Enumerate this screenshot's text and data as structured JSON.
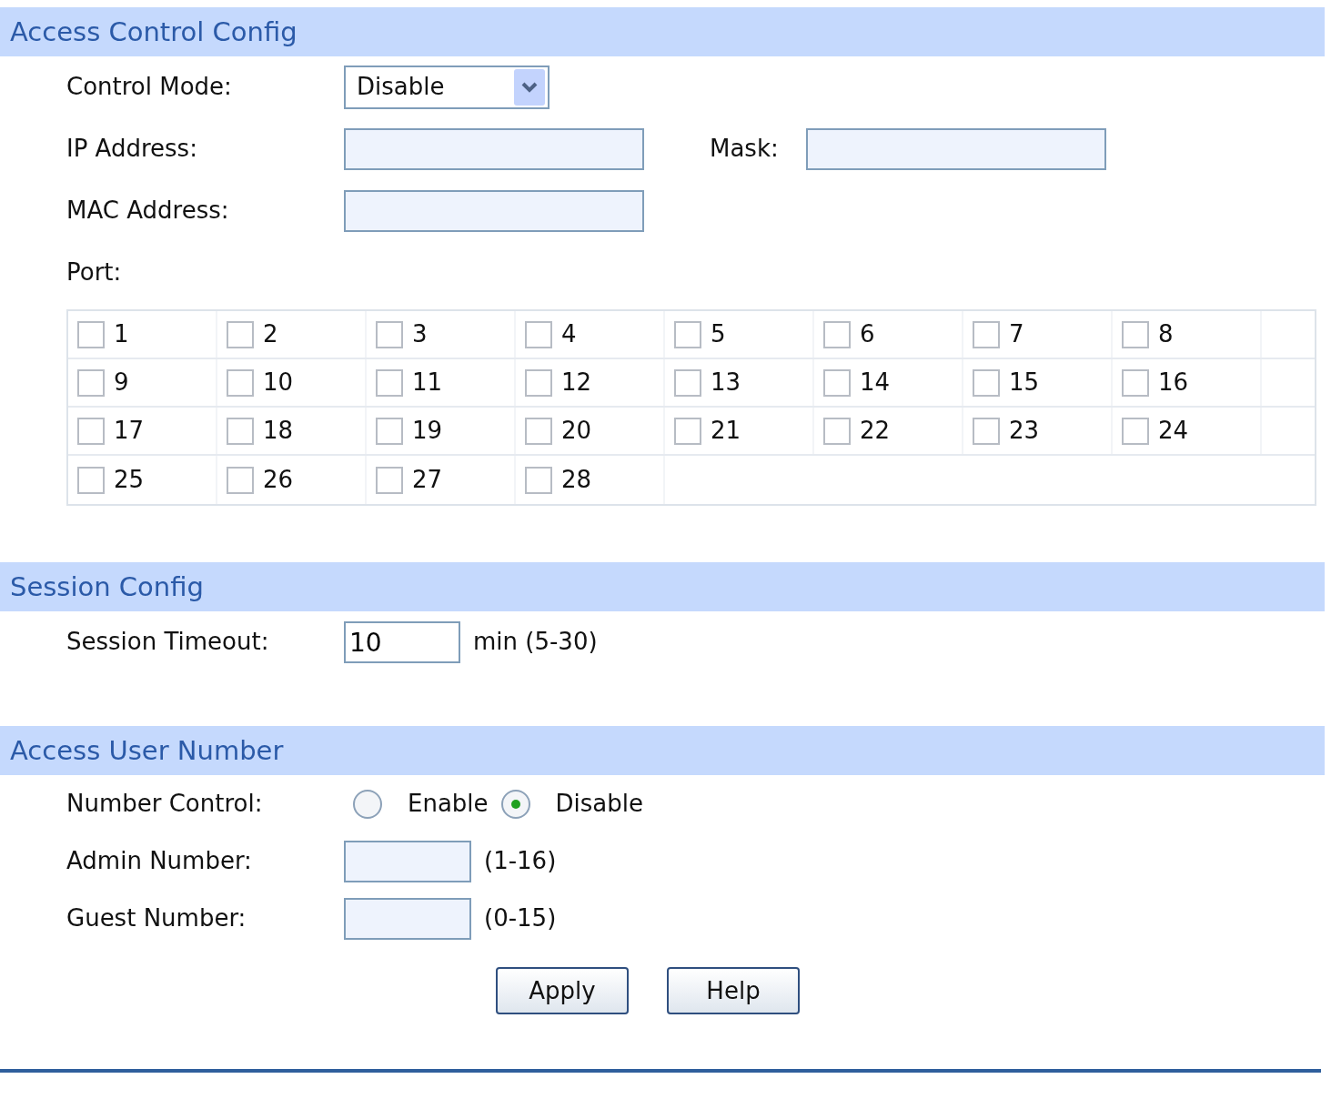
{
  "access_control": {
    "title": "Access Control Config",
    "control_mode": {
      "label": "Control Mode:",
      "value": "Disable"
    },
    "ip_address": {
      "label": "IP Address:"
    },
    "mask": {
      "label": "Mask:"
    },
    "mac_address": {
      "label": "MAC Address:"
    },
    "port_label": "Port:",
    "ports": [
      {
        "label": "1",
        "checked": false
      },
      {
        "label": "2",
        "checked": false
      },
      {
        "label": "3",
        "checked": false
      },
      {
        "label": "4",
        "checked": false
      },
      {
        "label": "5",
        "checked": false
      },
      {
        "label": "6",
        "checked": false
      },
      {
        "label": "7",
        "checked": false
      },
      {
        "label": "8",
        "checked": false
      },
      {
        "label": "9",
        "checked": false
      },
      {
        "label": "10",
        "checked": false
      },
      {
        "label": "11",
        "checked": false
      },
      {
        "label": "12",
        "checked": false
      },
      {
        "label": "13",
        "checked": false
      },
      {
        "label": "14",
        "checked": false
      },
      {
        "label": "15",
        "checked": false
      },
      {
        "label": "16",
        "checked": false
      },
      {
        "label": "17",
        "checked": false
      },
      {
        "label": "18",
        "checked": false
      },
      {
        "label": "19",
        "checked": false
      },
      {
        "label": "20",
        "checked": false
      },
      {
        "label": "21",
        "checked": false
      },
      {
        "label": "22",
        "checked": false
      },
      {
        "label": "23",
        "checked": false
      },
      {
        "label": "24",
        "checked": false
      },
      {
        "label": "25",
        "checked": false
      },
      {
        "label": "26",
        "checked": false
      },
      {
        "label": "27",
        "checked": false
      },
      {
        "label": "28",
        "checked": false
      }
    ]
  },
  "session": {
    "title": "Session Config",
    "timeout": {
      "label": "Session Timeout:",
      "value": "10",
      "hint": "min (5-30)"
    }
  },
  "user_number": {
    "title": "Access User Number",
    "number_control": {
      "label": "Number Control:",
      "options": [
        {
          "label": "Enable",
          "selected": false
        },
        {
          "label": "Disable",
          "selected": true
        }
      ]
    },
    "admin": {
      "label": "Admin Number:",
      "hint": "(1-16)"
    },
    "guest": {
      "label": "Guest Number:",
      "hint": "(0-15)"
    }
  },
  "buttons": [
    "Apply",
    "Help"
  ]
}
